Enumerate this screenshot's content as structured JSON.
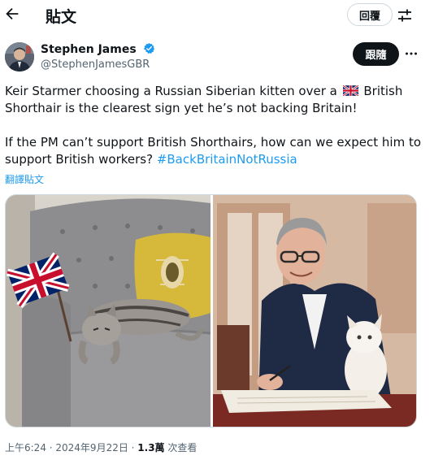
{
  "header": {
    "title": "貼文",
    "reply_label": "回覆",
    "back_icon": "arrow-left-icon",
    "filter_icon": "sliders-icon"
  },
  "author": {
    "name": "Stephen James",
    "handle": "@StephenJamesGBR",
    "follow_label": "跟隨",
    "verified_color": "#1d9bf0"
  },
  "tweet": {
    "line1a": "Keir Starmer choosing a Russian Siberian kitten over a ",
    "line1b": " British",
    "line2": "Shorthair is the clearest sign yet he’s not backing Britain!",
    "line3": "If the PM can’t support British Shorthairs, how can we expect him to",
    "line4": "support British workers? ",
    "hashtag": "#BackBritainNotRussia",
    "translate": "翻譯貼文"
  },
  "meta": {
    "time": "上午6:24 · 2024年9月22日 · ",
    "views_count": "1.3萬",
    "views_label": " 次查看"
  },
  "colors": {
    "accent": "#1d9bf0",
    "text": "#0f1419",
    "muted": "#536471",
    "border": "#cfd9de"
  }
}
